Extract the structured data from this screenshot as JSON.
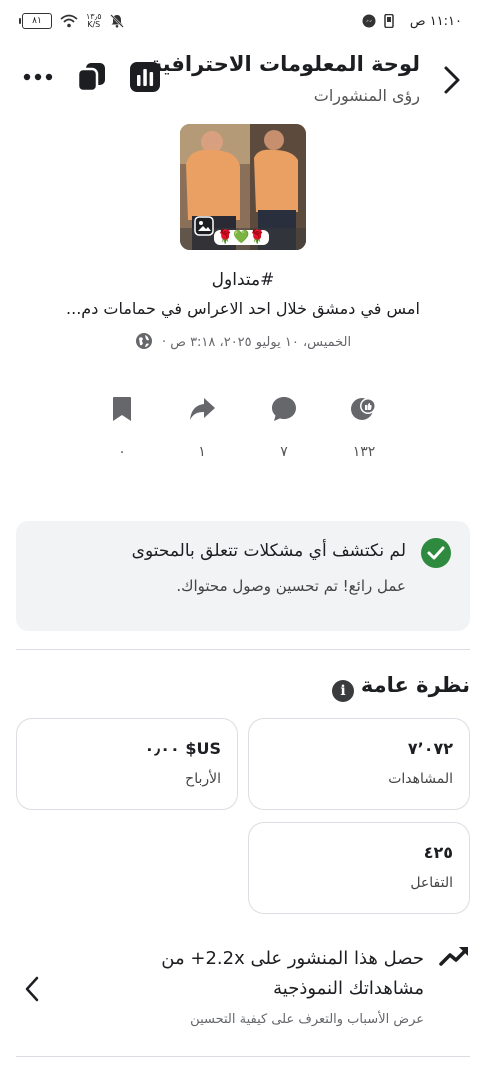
{
  "status_bar": {
    "time": "١١:١٠ ص",
    "battery": "٨١",
    "speed_value": "١٣٫٥",
    "speed_unit": "K/S"
  },
  "header": {
    "title": "لوحة المعلومات الاحترافية",
    "subtitle": "رؤى المنشورات"
  },
  "post": {
    "hashtag": "#متداول",
    "caption": "امس في دمشق خلال احد الاعراس في حمامات دم...",
    "date": "الخميس، ١٠ يوليو ٢٠٢٥، ٣:١٨ ص ·",
    "thumb_emojis": "🌹💚🌹"
  },
  "stats": [
    {
      "icon": "reactions-icon",
      "value": "١٣٢"
    },
    {
      "icon": "comment-icon",
      "value": "٧"
    },
    {
      "icon": "share-icon",
      "value": "١"
    },
    {
      "icon": "bookmark-icon",
      "value": "٠"
    }
  ],
  "status_card": {
    "title": "لم نكتشف أي مشكلات تتعلق بالمحتوى",
    "description": "عمل رائع! تم تحسين وصول محتواك."
  },
  "overview": {
    "title": "نظرة عامة",
    "metrics": [
      {
        "label": "المشاهدات",
        "value": "٧٬٠٧٢"
      },
      {
        "label": "الأرباح",
        "value": "US$ ٠٫٠٠"
      },
      {
        "label": "التفاعل",
        "value": "٤٢٥"
      }
    ]
  },
  "insight": {
    "title": "حصل هذا المنشور على 2.2x+ من مشاهداتك النموذجية",
    "subtitle": "عرض الأسباب والتعرف على كيفية التحسين"
  }
}
